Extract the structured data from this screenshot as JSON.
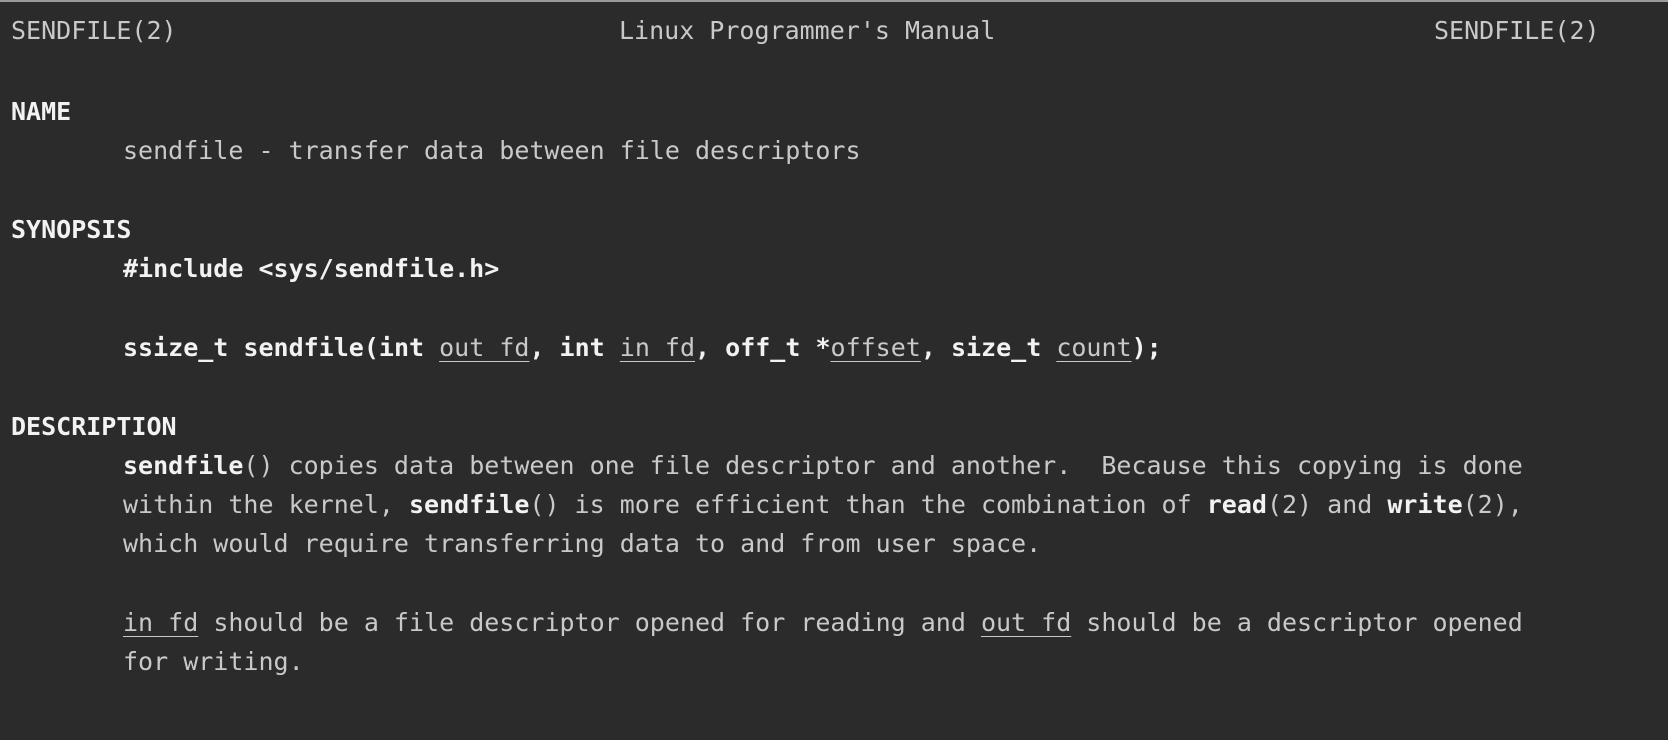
{
  "header": {
    "left": "SENDFILE(2)",
    "center": "Linux Programmer's Manual",
    "right": "SENDFILE(2)"
  },
  "sections": {
    "name": {
      "heading": "NAME",
      "text": "sendfile - transfer data between file descriptors"
    },
    "synopsis": {
      "heading": "SYNOPSIS",
      "include": "#include <sys/sendfile.h>",
      "proto": {
        "ret_type": "ssize_t",
        "func": "sendfile",
        "open_paren": "(",
        "t1": "int",
        "p1": "out_fd",
        "sep1": ", ",
        "t2": "int",
        "p2": "in_fd",
        "sep2": ", ",
        "t3": "off_t",
        "star": "*",
        "p3": "offset",
        "sep3": ", ",
        "t4": "size_t",
        "p4": "count",
        "close": ");"
      }
    },
    "description": {
      "heading": "DESCRIPTION",
      "para1": {
        "l1_bold": "sendfile",
        "l1_rest": "() copies data between one file descriptor and another.  Because this copying is done",
        "l2_a": "within the kernel, ",
        "l2_bold1": "sendfile",
        "l2_b": "() is more efficient than the combination of ",
        "l2_bold2": "read",
        "l2_c": "(2) and ",
        "l2_bold3": "write",
        "l2_d": "(2),",
        "l3": "which would require transferring data to and from user space."
      },
      "para2": {
        "u1": "in_fd",
        "t1": " should be a file descriptor opened for reading and ",
        "u2": "out_fd",
        "t2": " should be a descriptor opened",
        "l2": "for writing."
      }
    }
  }
}
